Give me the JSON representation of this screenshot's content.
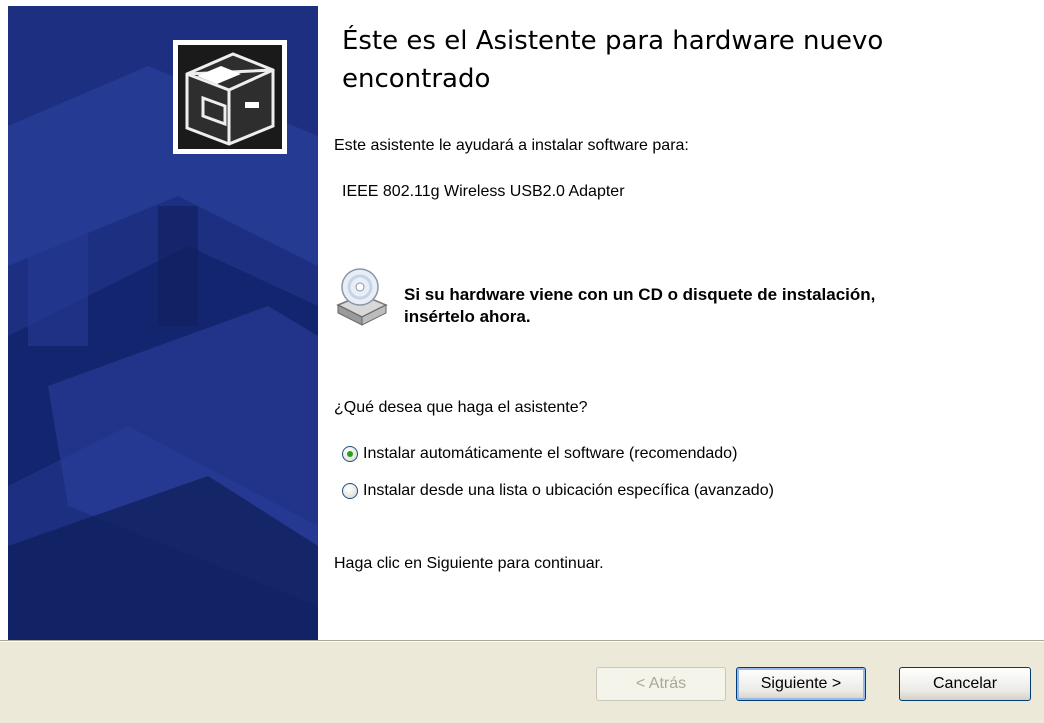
{
  "wizard": {
    "title": "Éste es el Asistente para hardware nuevo encontrado",
    "intro": "Este asistente le ayudará a instalar software para:",
    "device_name": "IEEE 802.11g Wireless USB2.0 Adapter",
    "cd_notice": "Si su hardware viene con un CD o disquete de instalación, insértelo ahora.",
    "question": "¿Qué desea que haga el asistente?",
    "options": [
      {
        "label": "Instalar automáticamente el software (recomendado)",
        "checked": true
      },
      {
        "label": "Instalar desde una lista o ubicación específica (avanzado)",
        "checked": false
      }
    ],
    "continue_hint": "Haga clic en Siguiente para continuar.",
    "icons": {
      "banner": "hardware-drawer-icon",
      "cd": "cd-drive-icon"
    },
    "buttons": {
      "back": {
        "label": "< Atrás",
        "enabled": false
      },
      "next": {
        "label": "Siguiente >",
        "enabled": true
      },
      "cancel": {
        "label": "Cancelar",
        "enabled": true
      }
    },
    "colors": {
      "banner": "#1c2f80",
      "footer": "#ece9d8",
      "radio_selected": "#2a9c1e"
    }
  }
}
